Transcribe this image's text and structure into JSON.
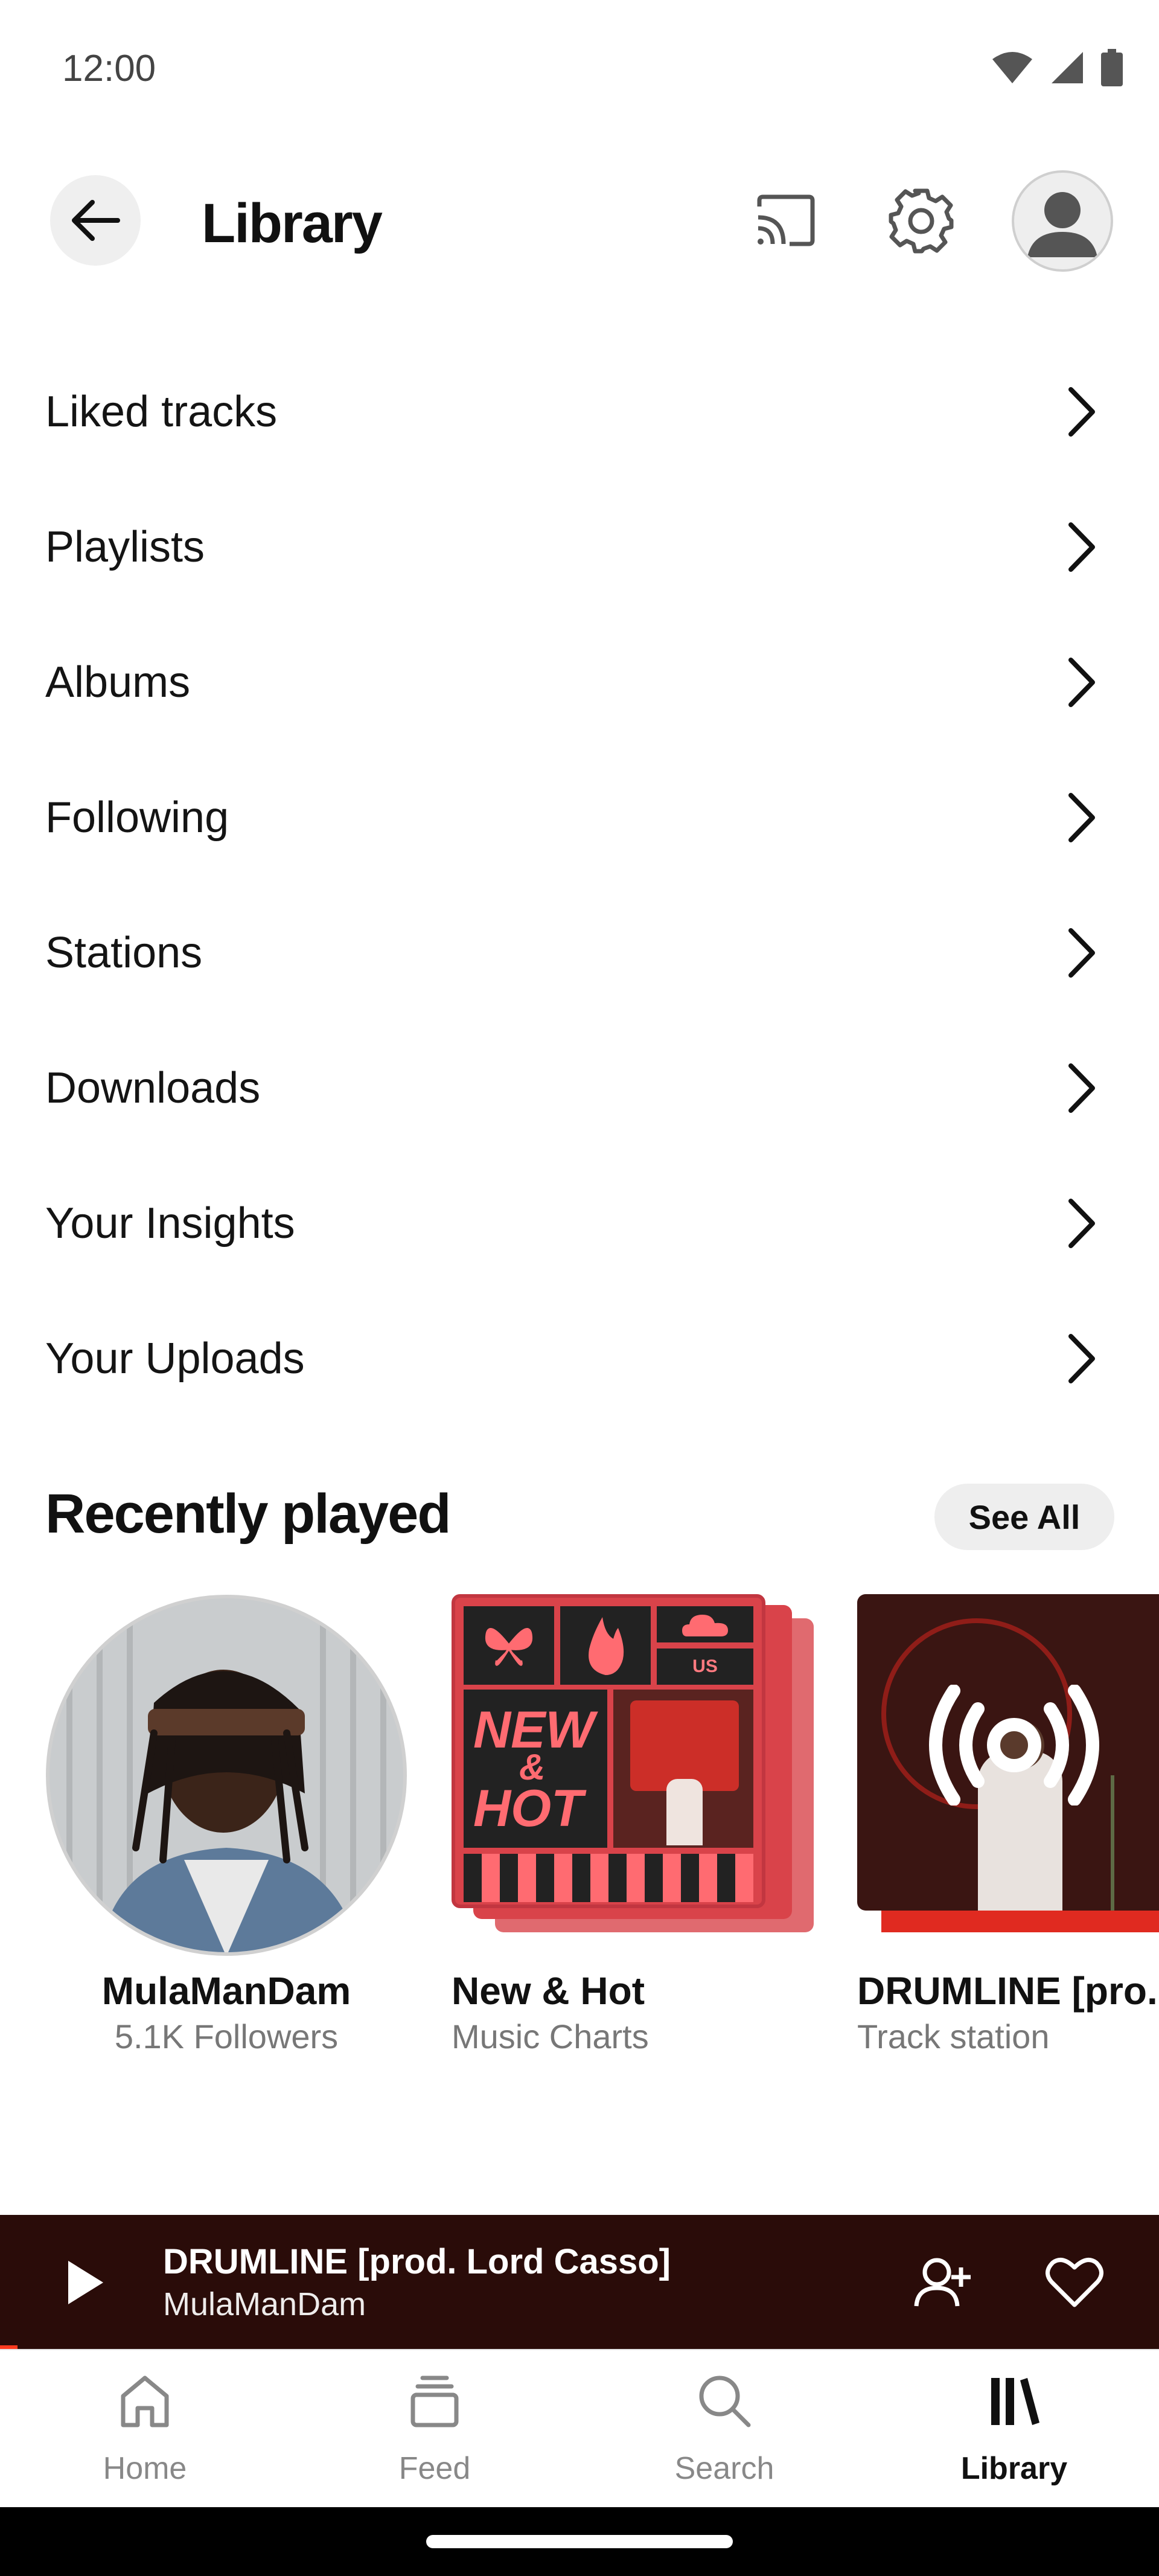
{
  "status_bar": {
    "time": "12:00"
  },
  "header": {
    "title": "Library"
  },
  "menu": [
    {
      "label": "Liked tracks"
    },
    {
      "label": "Playlists"
    },
    {
      "label": "Albums"
    },
    {
      "label": "Following"
    },
    {
      "label": "Stations"
    },
    {
      "label": "Downloads"
    },
    {
      "label": "Your Insights"
    },
    {
      "label": "Your Uploads"
    }
  ],
  "recently_played": {
    "title": "Recently played",
    "see_all": "See All",
    "items": [
      {
        "title": "MulaManDam",
        "subtitle": "5.1K Followers"
      },
      {
        "title": "New & Hot",
        "subtitle": "Music Charts",
        "art_text_top": "NEW",
        "art_text_mid": "&",
        "art_text_bottom": "HOT",
        "art_badge": "US"
      },
      {
        "title": "DRUMLINE [pro.",
        "subtitle": "Track station"
      }
    ]
  },
  "mini_player": {
    "title": "DRUMLINE [prod. Lord Casso]",
    "artist": "MulaManDam",
    "progress": 0.015
  },
  "bottom_nav": [
    {
      "label": "Home",
      "icon": "home-icon"
    },
    {
      "label": "Feed",
      "icon": "feed-icon"
    },
    {
      "label": "Search",
      "icon": "search-icon"
    },
    {
      "label": "Library",
      "icon": "library-icon",
      "active": true
    }
  ],
  "colors": {
    "accent": "#ff3b1f",
    "mini_player_bg": "#2a0c09",
    "chart_art_bg": "#d9434a"
  }
}
